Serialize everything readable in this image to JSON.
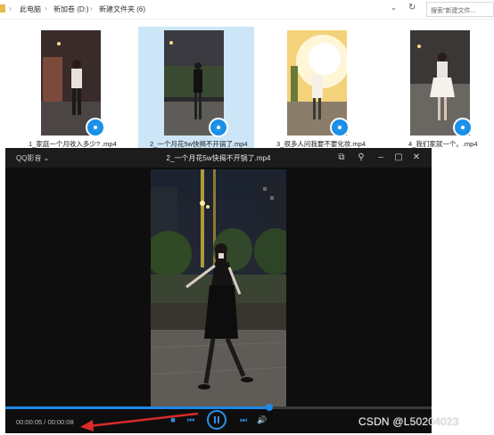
{
  "explorer": {
    "breadcrumb": [
      "此电脑",
      "新加卷 (D:)",
      "新建文件夹 (6)"
    ],
    "search_placeholder": "搜索\"新建文件..."
  },
  "files": [
    {
      "name": "1_家庭一个月收入多少? .mp4",
      "selected": false
    },
    {
      "name": "2_一个月花5w快揭不开锅了.mp4",
      "selected": true
    },
    {
      "name": "3_很多人问我要不要化妆.mp4",
      "selected": false
    },
    {
      "name": "4_我们家就一个。.mp4",
      "selected": false
    }
  ],
  "player": {
    "brand": "QQ影音",
    "title": "2_一个月花5w快揭不开锅了.mp4",
    "time": "00:00:05 / 00:00:08",
    "progress": 0.62,
    "accent": "#1e88e5"
  },
  "watermark": "CSDN @L50204023"
}
